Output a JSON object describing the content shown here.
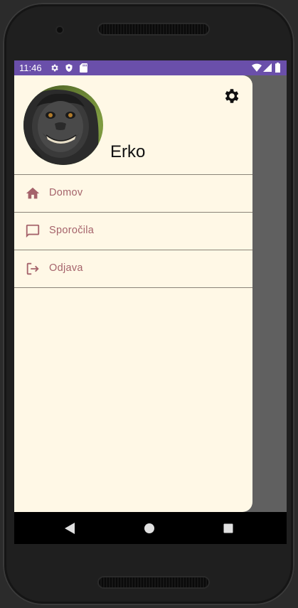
{
  "status_bar": {
    "time": "11:46",
    "color": "#6a4faa",
    "left_icons": [
      "gear-icon",
      "shield-icon",
      "sd-card-icon"
    ],
    "right_icons": [
      "wifi-icon",
      "signal-icon",
      "battery-icon"
    ]
  },
  "drawer": {
    "background": "#fff8e6",
    "header": {
      "username": "Erko",
      "avatar": "monkey-selfie-avatar",
      "settings_icon": "gear-icon"
    },
    "menu_items": [
      {
        "label": "Domov",
        "icon": "home-icon"
      },
      {
        "label": "Sporočila",
        "icon": "message-icon"
      },
      {
        "label": "Odjava",
        "icon": "logout-icon"
      }
    ],
    "accent": "#a5636b"
  },
  "nav_bar": {
    "buttons": [
      "back-icon",
      "home-circle-icon",
      "recents-icon"
    ]
  }
}
